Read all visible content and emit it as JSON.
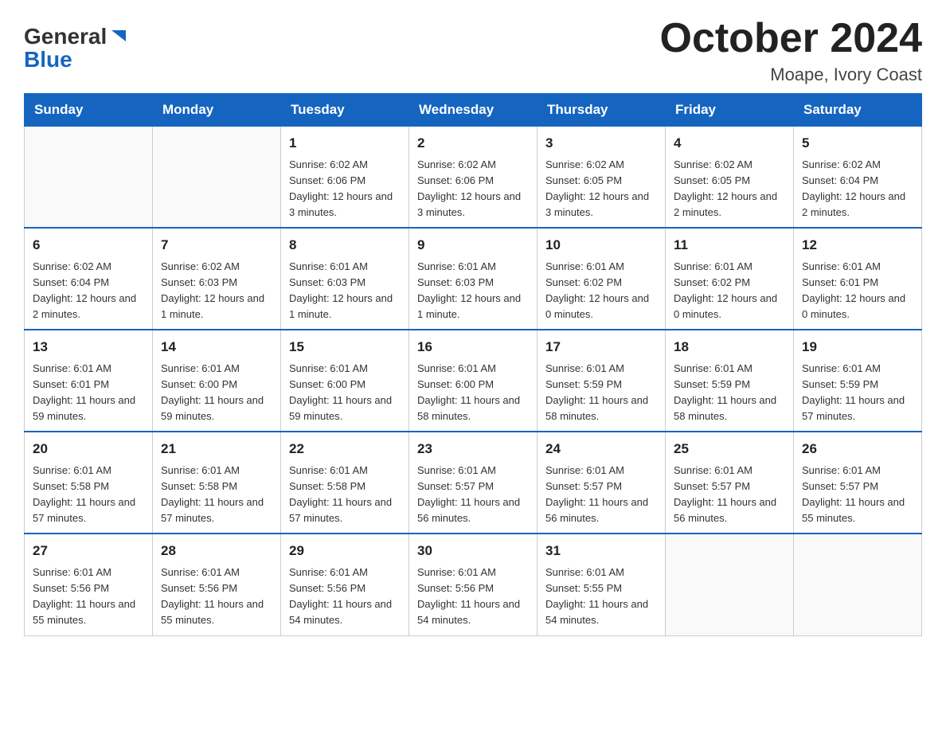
{
  "logo": {
    "general": "General",
    "blue": "Blue"
  },
  "title": "October 2024",
  "location": "Moape, Ivory Coast",
  "days_of_week": [
    "Sunday",
    "Monday",
    "Tuesday",
    "Wednesday",
    "Thursday",
    "Friday",
    "Saturday"
  ],
  "weeks": [
    [
      {
        "day": "",
        "info": ""
      },
      {
        "day": "",
        "info": ""
      },
      {
        "day": "1",
        "info": "Sunrise: 6:02 AM\nSunset: 6:06 PM\nDaylight: 12 hours and 3 minutes."
      },
      {
        "day": "2",
        "info": "Sunrise: 6:02 AM\nSunset: 6:06 PM\nDaylight: 12 hours and 3 minutes."
      },
      {
        "day": "3",
        "info": "Sunrise: 6:02 AM\nSunset: 6:05 PM\nDaylight: 12 hours and 3 minutes."
      },
      {
        "day": "4",
        "info": "Sunrise: 6:02 AM\nSunset: 6:05 PM\nDaylight: 12 hours and 2 minutes."
      },
      {
        "day": "5",
        "info": "Sunrise: 6:02 AM\nSunset: 6:04 PM\nDaylight: 12 hours and 2 minutes."
      }
    ],
    [
      {
        "day": "6",
        "info": "Sunrise: 6:02 AM\nSunset: 6:04 PM\nDaylight: 12 hours and 2 minutes."
      },
      {
        "day": "7",
        "info": "Sunrise: 6:02 AM\nSunset: 6:03 PM\nDaylight: 12 hours and 1 minute."
      },
      {
        "day": "8",
        "info": "Sunrise: 6:01 AM\nSunset: 6:03 PM\nDaylight: 12 hours and 1 minute."
      },
      {
        "day": "9",
        "info": "Sunrise: 6:01 AM\nSunset: 6:03 PM\nDaylight: 12 hours and 1 minute."
      },
      {
        "day": "10",
        "info": "Sunrise: 6:01 AM\nSunset: 6:02 PM\nDaylight: 12 hours and 0 minutes."
      },
      {
        "day": "11",
        "info": "Sunrise: 6:01 AM\nSunset: 6:02 PM\nDaylight: 12 hours and 0 minutes."
      },
      {
        "day": "12",
        "info": "Sunrise: 6:01 AM\nSunset: 6:01 PM\nDaylight: 12 hours and 0 minutes."
      }
    ],
    [
      {
        "day": "13",
        "info": "Sunrise: 6:01 AM\nSunset: 6:01 PM\nDaylight: 11 hours and 59 minutes."
      },
      {
        "day": "14",
        "info": "Sunrise: 6:01 AM\nSunset: 6:00 PM\nDaylight: 11 hours and 59 minutes."
      },
      {
        "day": "15",
        "info": "Sunrise: 6:01 AM\nSunset: 6:00 PM\nDaylight: 11 hours and 59 minutes."
      },
      {
        "day": "16",
        "info": "Sunrise: 6:01 AM\nSunset: 6:00 PM\nDaylight: 11 hours and 58 minutes."
      },
      {
        "day": "17",
        "info": "Sunrise: 6:01 AM\nSunset: 5:59 PM\nDaylight: 11 hours and 58 minutes."
      },
      {
        "day": "18",
        "info": "Sunrise: 6:01 AM\nSunset: 5:59 PM\nDaylight: 11 hours and 58 minutes."
      },
      {
        "day": "19",
        "info": "Sunrise: 6:01 AM\nSunset: 5:59 PM\nDaylight: 11 hours and 57 minutes."
      }
    ],
    [
      {
        "day": "20",
        "info": "Sunrise: 6:01 AM\nSunset: 5:58 PM\nDaylight: 11 hours and 57 minutes."
      },
      {
        "day": "21",
        "info": "Sunrise: 6:01 AM\nSunset: 5:58 PM\nDaylight: 11 hours and 57 minutes."
      },
      {
        "day": "22",
        "info": "Sunrise: 6:01 AM\nSunset: 5:58 PM\nDaylight: 11 hours and 57 minutes."
      },
      {
        "day": "23",
        "info": "Sunrise: 6:01 AM\nSunset: 5:57 PM\nDaylight: 11 hours and 56 minutes."
      },
      {
        "day": "24",
        "info": "Sunrise: 6:01 AM\nSunset: 5:57 PM\nDaylight: 11 hours and 56 minutes."
      },
      {
        "day": "25",
        "info": "Sunrise: 6:01 AM\nSunset: 5:57 PM\nDaylight: 11 hours and 56 minutes."
      },
      {
        "day": "26",
        "info": "Sunrise: 6:01 AM\nSunset: 5:57 PM\nDaylight: 11 hours and 55 minutes."
      }
    ],
    [
      {
        "day": "27",
        "info": "Sunrise: 6:01 AM\nSunset: 5:56 PM\nDaylight: 11 hours and 55 minutes."
      },
      {
        "day": "28",
        "info": "Sunrise: 6:01 AM\nSunset: 5:56 PM\nDaylight: 11 hours and 55 minutes."
      },
      {
        "day": "29",
        "info": "Sunrise: 6:01 AM\nSunset: 5:56 PM\nDaylight: 11 hours and 54 minutes."
      },
      {
        "day": "30",
        "info": "Sunrise: 6:01 AM\nSunset: 5:56 PM\nDaylight: 11 hours and 54 minutes."
      },
      {
        "day": "31",
        "info": "Sunrise: 6:01 AM\nSunset: 5:55 PM\nDaylight: 11 hours and 54 minutes."
      },
      {
        "day": "",
        "info": ""
      },
      {
        "day": "",
        "info": ""
      }
    ]
  ]
}
